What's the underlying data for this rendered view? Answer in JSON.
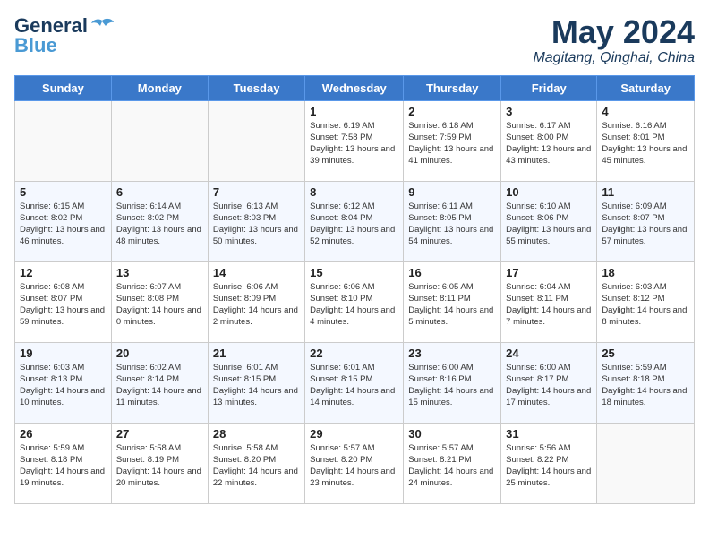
{
  "header": {
    "logo_general": "General",
    "logo_blue": "Blue",
    "month": "May 2024",
    "location": "Magitang, Qinghai, China"
  },
  "weekdays": [
    "Sunday",
    "Monday",
    "Tuesday",
    "Wednesday",
    "Thursday",
    "Friday",
    "Saturday"
  ],
  "weeks": [
    [
      {
        "day": "",
        "sunrise": "",
        "sunset": "",
        "daylight": ""
      },
      {
        "day": "",
        "sunrise": "",
        "sunset": "",
        "daylight": ""
      },
      {
        "day": "",
        "sunrise": "",
        "sunset": "",
        "daylight": ""
      },
      {
        "day": "1",
        "sunrise": "Sunrise: 6:19 AM",
        "sunset": "Sunset: 7:58 PM",
        "daylight": "Daylight: 13 hours and 39 minutes."
      },
      {
        "day": "2",
        "sunrise": "Sunrise: 6:18 AM",
        "sunset": "Sunset: 7:59 PM",
        "daylight": "Daylight: 13 hours and 41 minutes."
      },
      {
        "day": "3",
        "sunrise": "Sunrise: 6:17 AM",
        "sunset": "Sunset: 8:00 PM",
        "daylight": "Daylight: 13 hours and 43 minutes."
      },
      {
        "day": "4",
        "sunrise": "Sunrise: 6:16 AM",
        "sunset": "Sunset: 8:01 PM",
        "daylight": "Daylight: 13 hours and 45 minutes."
      }
    ],
    [
      {
        "day": "5",
        "sunrise": "Sunrise: 6:15 AM",
        "sunset": "Sunset: 8:02 PM",
        "daylight": "Daylight: 13 hours and 46 minutes."
      },
      {
        "day": "6",
        "sunrise": "Sunrise: 6:14 AM",
        "sunset": "Sunset: 8:02 PM",
        "daylight": "Daylight: 13 hours and 48 minutes."
      },
      {
        "day": "7",
        "sunrise": "Sunrise: 6:13 AM",
        "sunset": "Sunset: 8:03 PM",
        "daylight": "Daylight: 13 hours and 50 minutes."
      },
      {
        "day": "8",
        "sunrise": "Sunrise: 6:12 AM",
        "sunset": "Sunset: 8:04 PM",
        "daylight": "Daylight: 13 hours and 52 minutes."
      },
      {
        "day": "9",
        "sunrise": "Sunrise: 6:11 AM",
        "sunset": "Sunset: 8:05 PM",
        "daylight": "Daylight: 13 hours and 54 minutes."
      },
      {
        "day": "10",
        "sunrise": "Sunrise: 6:10 AM",
        "sunset": "Sunset: 8:06 PM",
        "daylight": "Daylight: 13 hours and 55 minutes."
      },
      {
        "day": "11",
        "sunrise": "Sunrise: 6:09 AM",
        "sunset": "Sunset: 8:07 PM",
        "daylight": "Daylight: 13 hours and 57 minutes."
      }
    ],
    [
      {
        "day": "12",
        "sunrise": "Sunrise: 6:08 AM",
        "sunset": "Sunset: 8:07 PM",
        "daylight": "Daylight: 13 hours and 59 minutes."
      },
      {
        "day": "13",
        "sunrise": "Sunrise: 6:07 AM",
        "sunset": "Sunset: 8:08 PM",
        "daylight": "Daylight: 14 hours and 0 minutes."
      },
      {
        "day": "14",
        "sunrise": "Sunrise: 6:06 AM",
        "sunset": "Sunset: 8:09 PM",
        "daylight": "Daylight: 14 hours and 2 minutes."
      },
      {
        "day": "15",
        "sunrise": "Sunrise: 6:06 AM",
        "sunset": "Sunset: 8:10 PM",
        "daylight": "Daylight: 14 hours and 4 minutes."
      },
      {
        "day": "16",
        "sunrise": "Sunrise: 6:05 AM",
        "sunset": "Sunset: 8:11 PM",
        "daylight": "Daylight: 14 hours and 5 minutes."
      },
      {
        "day": "17",
        "sunrise": "Sunrise: 6:04 AM",
        "sunset": "Sunset: 8:11 PM",
        "daylight": "Daylight: 14 hours and 7 minutes."
      },
      {
        "day": "18",
        "sunrise": "Sunrise: 6:03 AM",
        "sunset": "Sunset: 8:12 PM",
        "daylight": "Daylight: 14 hours and 8 minutes."
      }
    ],
    [
      {
        "day": "19",
        "sunrise": "Sunrise: 6:03 AM",
        "sunset": "Sunset: 8:13 PM",
        "daylight": "Daylight: 14 hours and 10 minutes."
      },
      {
        "day": "20",
        "sunrise": "Sunrise: 6:02 AM",
        "sunset": "Sunset: 8:14 PM",
        "daylight": "Daylight: 14 hours and 11 minutes."
      },
      {
        "day": "21",
        "sunrise": "Sunrise: 6:01 AM",
        "sunset": "Sunset: 8:15 PM",
        "daylight": "Daylight: 14 hours and 13 minutes."
      },
      {
        "day": "22",
        "sunrise": "Sunrise: 6:01 AM",
        "sunset": "Sunset: 8:15 PM",
        "daylight": "Daylight: 14 hours and 14 minutes."
      },
      {
        "day": "23",
        "sunrise": "Sunrise: 6:00 AM",
        "sunset": "Sunset: 8:16 PM",
        "daylight": "Daylight: 14 hours and 15 minutes."
      },
      {
        "day": "24",
        "sunrise": "Sunrise: 6:00 AM",
        "sunset": "Sunset: 8:17 PM",
        "daylight": "Daylight: 14 hours and 17 minutes."
      },
      {
        "day": "25",
        "sunrise": "Sunrise: 5:59 AM",
        "sunset": "Sunset: 8:18 PM",
        "daylight": "Daylight: 14 hours and 18 minutes."
      }
    ],
    [
      {
        "day": "26",
        "sunrise": "Sunrise: 5:59 AM",
        "sunset": "Sunset: 8:18 PM",
        "daylight": "Daylight: 14 hours and 19 minutes."
      },
      {
        "day": "27",
        "sunrise": "Sunrise: 5:58 AM",
        "sunset": "Sunset: 8:19 PM",
        "daylight": "Daylight: 14 hours and 20 minutes."
      },
      {
        "day": "28",
        "sunrise": "Sunrise: 5:58 AM",
        "sunset": "Sunset: 8:20 PM",
        "daylight": "Daylight: 14 hours and 22 minutes."
      },
      {
        "day": "29",
        "sunrise": "Sunrise: 5:57 AM",
        "sunset": "Sunset: 8:20 PM",
        "daylight": "Daylight: 14 hours and 23 minutes."
      },
      {
        "day": "30",
        "sunrise": "Sunrise: 5:57 AM",
        "sunset": "Sunset: 8:21 PM",
        "daylight": "Daylight: 14 hours and 24 minutes."
      },
      {
        "day": "31",
        "sunrise": "Sunrise: 5:56 AM",
        "sunset": "Sunset: 8:22 PM",
        "daylight": "Daylight: 14 hours and 25 minutes."
      },
      {
        "day": "",
        "sunrise": "",
        "sunset": "",
        "daylight": ""
      }
    ]
  ]
}
